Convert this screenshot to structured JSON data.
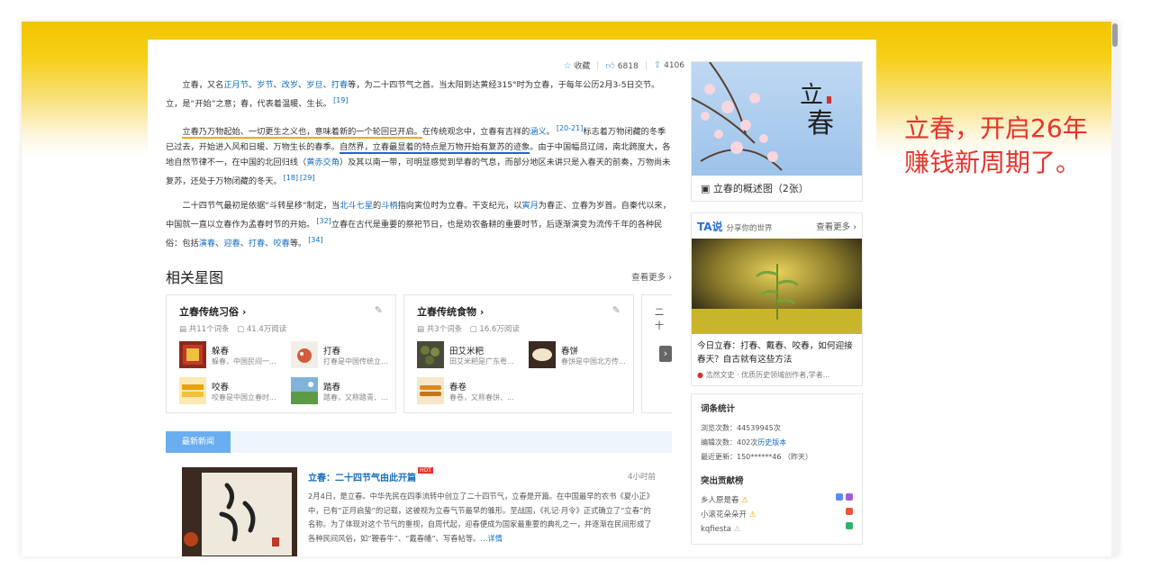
{
  "overlay": {
    "line1": "立春，开启26年",
    "line2": "赚钱新周期了。"
  },
  "actions": {
    "favorite": "收藏",
    "likes": "6818",
    "shares": "4106"
  },
  "para1": {
    "t1": "立春，又名",
    "l1": "正月节",
    "s1": "、",
    "l2": "岁节",
    "s2": "、",
    "l3": "改岁",
    "s3": "、",
    "l4": "岁旦",
    "s4": "、",
    "l5": "打春",
    "t2": "等，为二十四节气之首。当太阳到达黄经315°时为立春，于每年公历2月3-5日交节。立，是“开始”之意；春，代表着温暖、生长。",
    "ref": "[19]"
  },
  "para2": {
    "u1": "立春乃万物起始、一切更生之义也，意味着新的一个轮回已开启。",
    "t1": "在传统观念中，立春有吉祥的",
    "l1": "涵义",
    "t2": "。",
    "ref1": "[20-21]",
    "t3": "标志着万物闭藏的冬季已过去，开始进入风和日暖、万物生长的春季。",
    "u2": "自然界，立春最显着的特点是万物开始有复苏的迹象",
    "t4": "。由于中国幅员辽阔，南北跨度大，各地自然节律不一，在中国的北回归线（",
    "l2": "黄赤交角",
    "t5": "）及其以南一带，可明显感觉到早春的气息，而部分地区未讲只是入春天的前奏，万物尚未复苏，还处于万物闭藏的冬天。",
    "ref2": "[18]",
    "ref3": "[29]"
  },
  "para3": {
    "t1": "二十四节气最初是依据“斗转星移”制定，当",
    "l1": "北斗七星",
    "t2": "的",
    "l2": "斗柄",
    "t3": "指向寅位时为立春。干支纪元，以",
    "l3": "寅月",
    "t4": "为春正、立春为岁首。自秦代以来，中国就一直以立春作为孟春时节的开始。",
    "ref1": "[32]",
    "t5": "立春在古代是重要的祭祀节日，也是劝农备耕的重要时节，后逐渐演变为流传千年的各种民俗：包括",
    "l4": "演春",
    "s1": "、",
    "l5": "迎春",
    "s2": "、",
    "l6": "打春",
    "s3": "、",
    "l7": "咬春",
    "t6": "等。",
    "ref2": "[34]"
  },
  "related": {
    "title": "相关星图",
    "more": "查看更多",
    "cards": [
      {
        "title": "立春传统习俗",
        "count": "共11个词条",
        "reads": "41.4万阅读",
        "items": [
          {
            "name": "躲春",
            "desc": "躲春，中国民间一..."
          },
          {
            "name": "打春",
            "desc": "打春是中国传统立..."
          },
          {
            "name": "咬春",
            "desc": "咬春是中国立春时..."
          },
          {
            "name": "踏春",
            "desc": "踏春，又称踏青、..."
          }
        ]
      },
      {
        "title": "立春传统食物",
        "count": "共3个词条",
        "reads": "16.6万阅读",
        "items": [
          {
            "name": "田艾米粑",
            "desc": "田艾米粑是广东粤..."
          },
          {
            "name": "春饼",
            "desc": "春饼是中国北方传..."
          },
          {
            "name": "春卷",
            "desc": "春卷，又称春饼、..."
          }
        ]
      }
    ],
    "stub_text": "二十",
    "next_arrow": "›"
  },
  "news": {
    "tab": "最新新闻",
    "title": "立春：二十四节气由此开篇",
    "hot": "HOT",
    "time": "4小时前",
    "text": "2月4日，是立春。中华先民在四季流转中创立了二十四节气，立春是开篇。在中国最早的农书《夏小正》中，已有“正月启蛰”的记载，这被视为立春气节最早的雏形。至战国，《礼记·月令》正式确立了“立春”的名称。为了体现对这个节气的重视，自周代起，迎春便成为国家最重要的典礼之一，并逐渐在民间形成了各种民间风俗，如“鞭春牛”、“戴春幡”、写春帖等。...",
    "detail": "详情"
  },
  "sidebar": {
    "hero_caption": "立春的概述图（2张）",
    "ta_logo": "TA说",
    "ta_slogan": "分享你的世界",
    "ta_more": "查看更多",
    "ta_title": "今日立春：打春、戴春、咬春，如何迎接春天？自古就有这些方法",
    "ta_author": "浩然文史 · 优质历史领域创作者,学者...",
    "stats_title": "词条统计",
    "views": "浏览次数：44539945次",
    "edits_prefix": "编辑次数：402次",
    "edits_link": "历史版本",
    "last_update": "最近更新：150******46 （昨天）",
    "contrib_title": "突出贡献榜",
    "contributors": [
      "乡人原是春",
      "小滚花朵朵开",
      "kqfiesta"
    ]
  }
}
